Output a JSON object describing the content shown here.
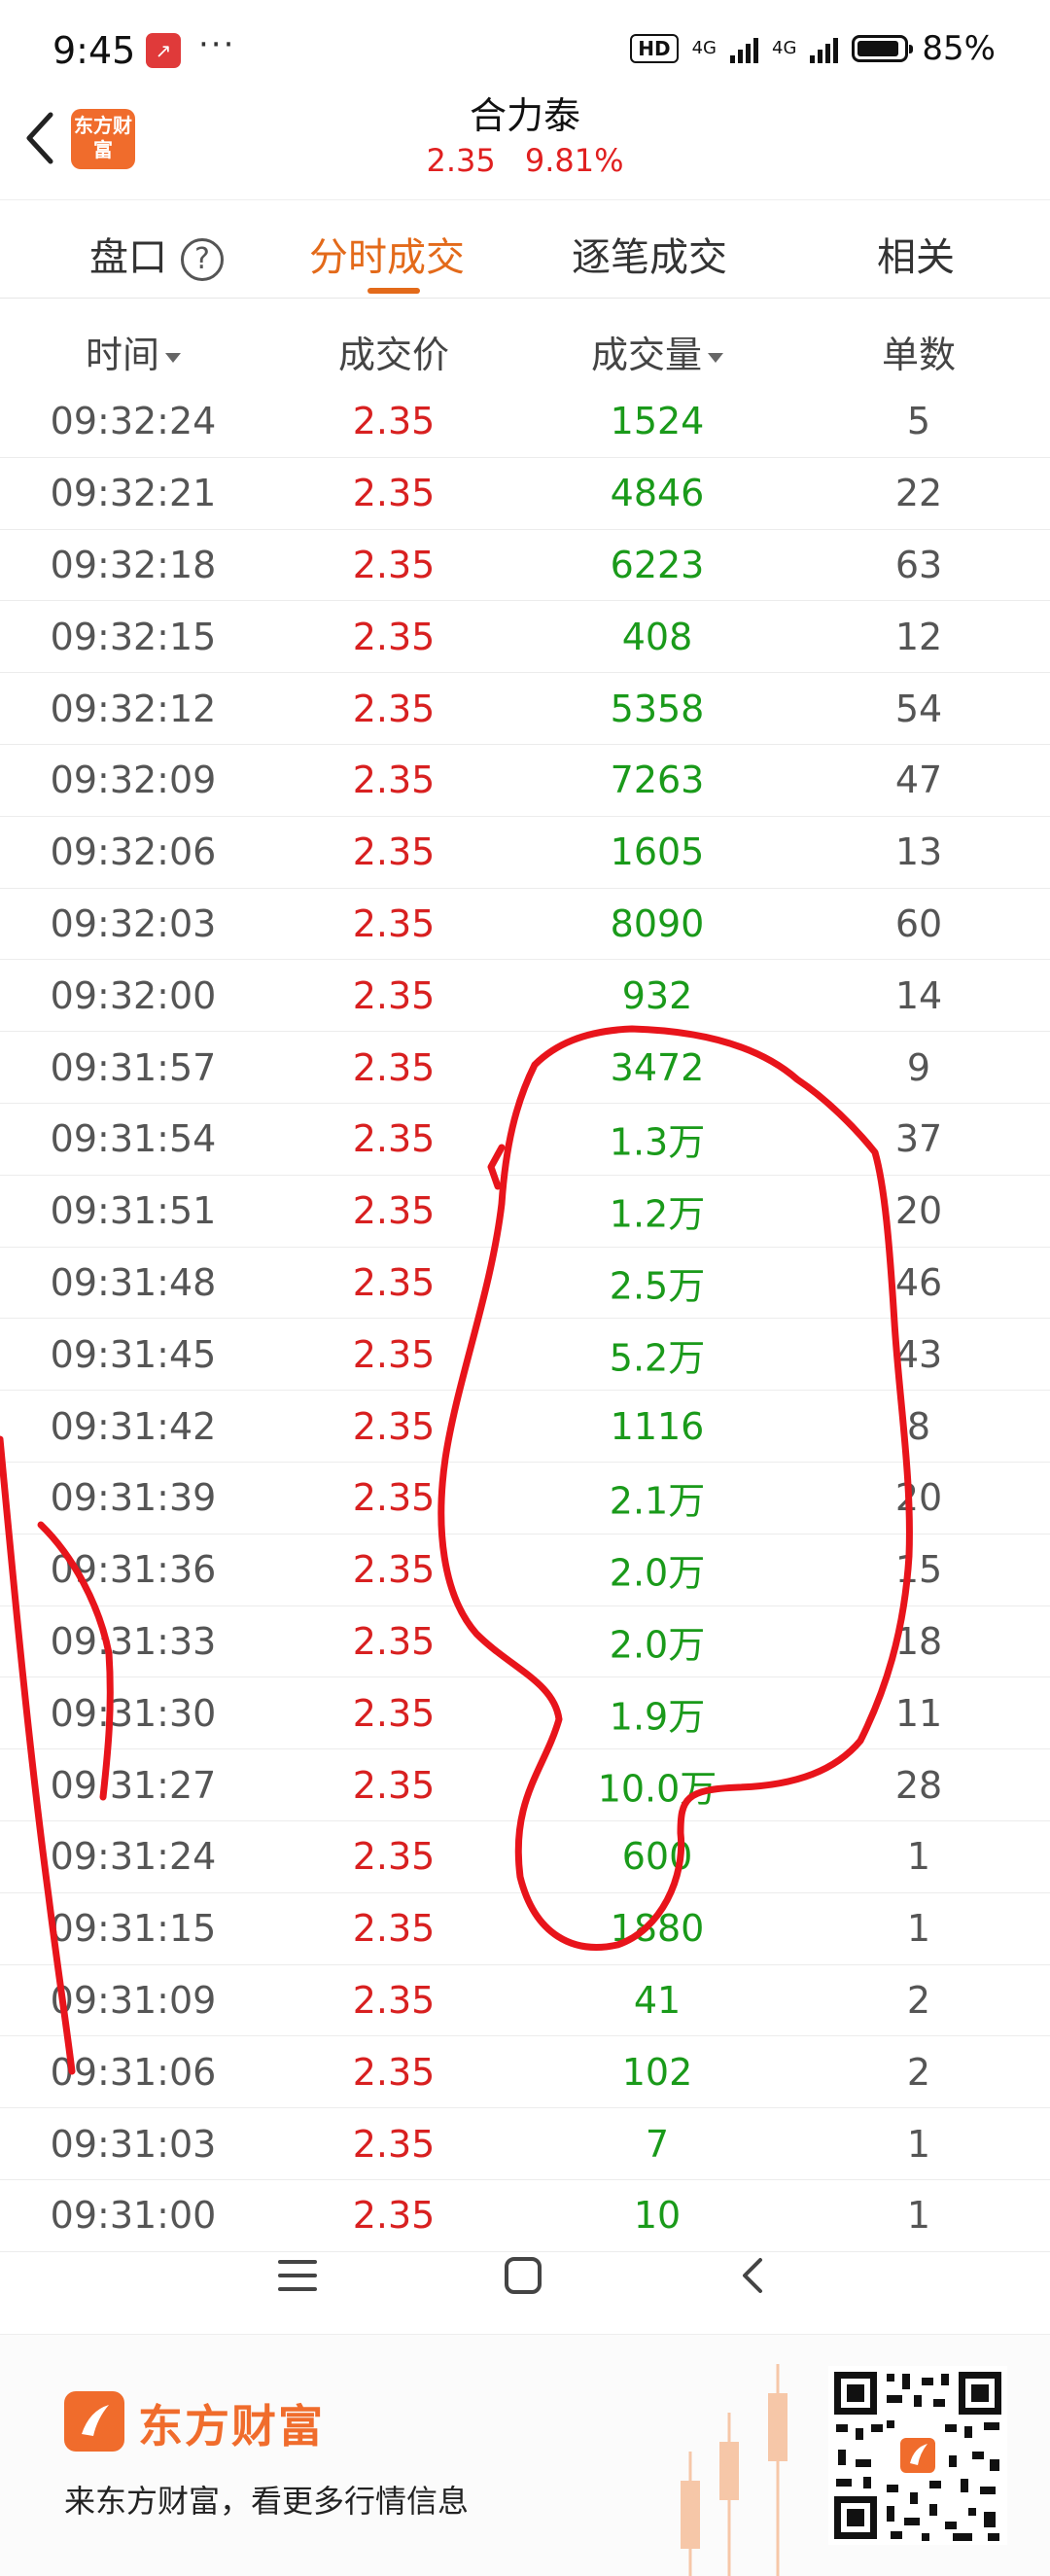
{
  "status_bar": {
    "time": "9:45",
    "dots": "···",
    "hd": "HD",
    "net1": "4G",
    "net2": "4G",
    "battery": "85%"
  },
  "header": {
    "logo_text": "东方财富",
    "stock_name": "合力泰",
    "price": "2.35",
    "change_pct": "9.81%"
  },
  "tabs": [
    {
      "label": "盘口"
    },
    {
      "label": "分时成交"
    },
    {
      "label": "逐笔成交"
    },
    {
      "label": "相关"
    }
  ],
  "table": {
    "columns": [
      "时间",
      "成交价",
      "成交量",
      "单数"
    ],
    "rows": [
      [
        "09:32:24",
        "2.35",
        "1524",
        "5"
      ],
      [
        "09:32:21",
        "2.35",
        "4846",
        "22"
      ],
      [
        "09:32:18",
        "2.35",
        "6223",
        "63"
      ],
      [
        "09:32:15",
        "2.35",
        "408",
        "12"
      ],
      [
        "09:32:12",
        "2.35",
        "5358",
        "54"
      ],
      [
        "09:32:09",
        "2.35",
        "7263",
        "47"
      ],
      [
        "09:32:06",
        "2.35",
        "1605",
        "13"
      ],
      [
        "09:32:03",
        "2.35",
        "8090",
        "60"
      ],
      [
        "09:32:00",
        "2.35",
        "932",
        "14"
      ],
      [
        "09:31:57",
        "2.35",
        "3472",
        "9"
      ],
      [
        "09:31:54",
        "2.35",
        "1.3万",
        "37"
      ],
      [
        "09:31:51",
        "2.35",
        "1.2万",
        "20"
      ],
      [
        "09:31:48",
        "2.35",
        "2.5万",
        "46"
      ],
      [
        "09:31:45",
        "2.35",
        "5.2万",
        "43"
      ],
      [
        "09:31:42",
        "2.35",
        "1116",
        "8"
      ],
      [
        "09:31:39",
        "2.35",
        "2.1万",
        "20"
      ],
      [
        "09:31:36",
        "2.35",
        "2.0万",
        "15"
      ],
      [
        "09:31:33",
        "2.35",
        "2.0万",
        "18"
      ],
      [
        "09:31:30",
        "2.35",
        "1.9万",
        "11"
      ],
      [
        "09:31:27",
        "2.35",
        "10.0万",
        "28"
      ],
      [
        "09:31:24",
        "2.35",
        "600",
        "1"
      ],
      [
        "09:31:15",
        "2.35",
        "1880",
        "1"
      ],
      [
        "09:31:09",
        "2.35",
        "41",
        "2"
      ],
      [
        "09:31:06",
        "2.35",
        "102",
        "2"
      ],
      [
        "09:31:03",
        "2.35",
        "7",
        "1"
      ],
      [
        "09:31:00",
        "2.35",
        "10",
        "1"
      ]
    ]
  },
  "footer": {
    "brand": "东方财富",
    "tagline": "来东方财富，看更多行情信息"
  },
  "colors": {
    "accent": "#e36a1a",
    "price_red": "#d82020",
    "volume_green": "#1a9a1a",
    "annotation": "#e8141b"
  }
}
